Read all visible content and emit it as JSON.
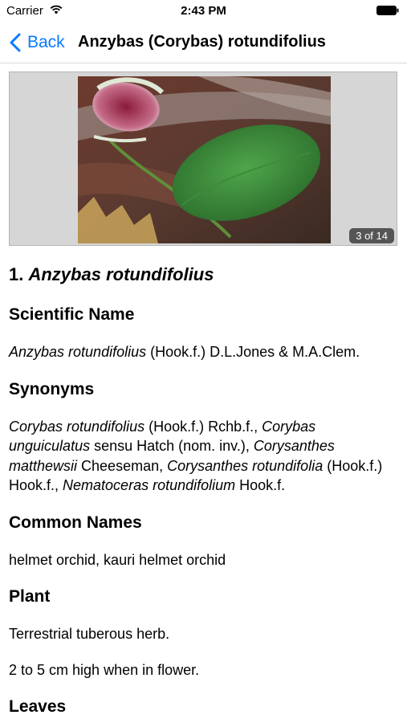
{
  "status_bar": {
    "carrier": "Carrier",
    "time": "2:43 PM"
  },
  "nav": {
    "back_label": "Back",
    "title": "Anzybas (Corybas) rotundifolius"
  },
  "gallery": {
    "counter": "3 of 14"
  },
  "species": {
    "number": "1.",
    "name": "Anzybas rotundifolius"
  },
  "sections": {
    "scientific_name": {
      "heading": "Scientific Name",
      "name": "Anzybas rotundifolius",
      "authority": " (Hook.f.) D.L.Jones & M.A.Clem."
    },
    "synonyms": {
      "heading": "Synonyms",
      "parts": [
        "Corybas rotundifolius",
        " (Hook.f.) Rchb.f., ",
        "Corybas unguiculatus",
        " sensu Hatch (nom. inv.), ",
        "Corysanthes matthewsii",
        " Cheeseman, ",
        "Corysanthes rotundifolia",
        " (Hook.f.) Hook.f., ",
        "Nematoceras rotundifolium",
        " Hook.f."
      ]
    },
    "common_names": {
      "heading": "Common Names",
      "text": "helmet orchid, kauri helmet orchid"
    },
    "plant": {
      "heading": "Plant",
      "lines": [
        "Terrestrial tuberous herb.",
        "2 to 5 cm high when in flower."
      ]
    },
    "leaves": {
      "heading": "Leaves"
    }
  },
  "colors": {
    "accent": "#0a7aff",
    "gallery_bg": "#d6d6d6",
    "counter_bg": "#555555"
  },
  "icons": [
    "wifi-icon",
    "battery-icon",
    "back-chevron-icon"
  ]
}
